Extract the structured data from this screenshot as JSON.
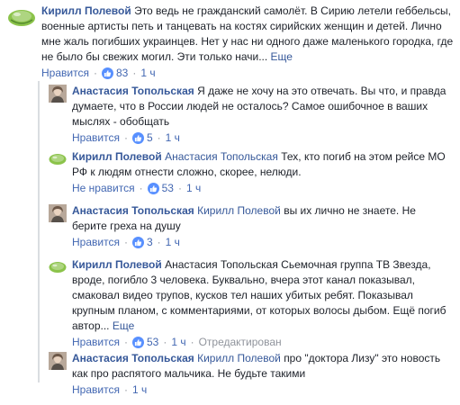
{
  "colors": {
    "link": "#365899",
    "action_link": "#4267b2",
    "meta": "#90949c",
    "text": "#1d2129",
    "like_badge": "#5890ff"
  },
  "comments": [
    {
      "author": "Кирилл Полевой",
      "avatar_icon": "green-leaf-avatar-icon",
      "text": "Это ведь не гражданский самолёт. В Сирию летели геббельсы, военные артисты петь и танцевать на костях сирийских женщин и детей. Лично мне жаль погибших украинцев. Нет у нас ни одного даже маленького городка, где не было бы свежих могил. Эти только начи...",
      "more": "Еще",
      "like": "Нравится",
      "reactions": "83",
      "time": "1 ч"
    },
    {
      "author": "Анастасия Топольская",
      "avatar_icon": "woman-photo-avatar-icon",
      "text": "Я даже не хочу на это отвечать. Вы что, и правда думаете, что в России людей не осталось? Самое ошибочное в ваших мыслях - обобщать",
      "like": "Нравится",
      "reactions": "5",
      "time": "1 ч"
    },
    {
      "author": "Кирилл Полевой",
      "avatar_icon": "green-leaf-avatar-icon",
      "tagged": "Анастасия Топольская",
      "text": "Тех, кто погиб на этом рейсе МО РФ к людям отнести сложно, скорее, нелюди.",
      "like": "Не нравится",
      "reactions": "53",
      "time": "1 ч"
    },
    {
      "author": "Анастасия Топольская",
      "avatar_icon": "woman-photo-avatar-icon",
      "tagged": "Кирилл Полевой",
      "text": "вы их лично не знаете. Не берите греха на душу",
      "like": "Нравится",
      "reactions": "3",
      "time": "1 ч"
    },
    {
      "author": "Кирилл Полевой",
      "avatar_icon": "green-leaf-avatar-icon",
      "text": "Анастасия Топольская Сьемочная группа ТВ Звезда, вроде, погибло 3 человека. Буквально, вчера этот канал показывал, смаковал видео трупов, кусков тел наших убитых ребят. Показывал крупным планом, с комментариями, от которых волосы дыбом. Ещё погиб автор...",
      "more": "Еще",
      "like": "Нравится",
      "reactions": "53",
      "time": "1 ч",
      "edited": "Отредактирован"
    },
    {
      "author": "Анастасия Топольская",
      "avatar_icon": "woman-photo-avatar-icon",
      "tagged": "Кирилл Полевой",
      "text": "про \"доктора Лизу\" это новость как про распятого мальчика. Не будьте такими",
      "like": "Нравится",
      "time": "1 ч"
    }
  ]
}
